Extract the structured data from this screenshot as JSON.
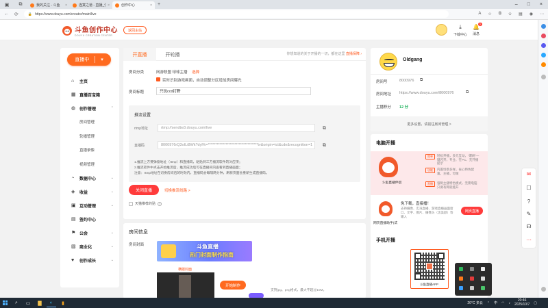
{
  "browser": {
    "tabs": [
      {
        "title": "我的关注 - 斗鱼",
        "active": false
      },
      {
        "title": "连寞之道 - 直播_优寞之道 -",
        "active": false
      },
      {
        "title": "创作中心",
        "active": true
      }
    ],
    "url": "https://www.douyu.com/creator/main/live"
  },
  "header": {
    "logo_text": "斗鱼创作中心",
    "logo_sub": "DOUYU CREATION CENTER",
    "home_button": "返回主站",
    "download_label": "下载中心",
    "message_label": "消息",
    "message_badge": "2"
  },
  "sidebar": {
    "live_button": "直播中",
    "items": [
      {
        "label": "主页",
        "icon": "home-icon",
        "type": "main"
      },
      {
        "label": "直播百宝箱",
        "icon": "toolbox-icon",
        "type": "main"
      },
      {
        "label": "创作管理",
        "icon": "location-icon",
        "type": "main",
        "expandable": true
      },
      {
        "label": "房间管理",
        "type": "sub"
      },
      {
        "label": "轮播管理",
        "type": "sub"
      },
      {
        "label": "直播录像",
        "type": "sub"
      },
      {
        "label": "视频管理",
        "type": "sub"
      },
      {
        "label": "数据中心",
        "icon": "data-icon",
        "type": "main",
        "expandable": true
      },
      {
        "label": "收益",
        "icon": "income-icon",
        "type": "main",
        "expandable": true
      },
      {
        "label": "互动管理",
        "icon": "interaction-icon",
        "type": "main",
        "expandable": true
      },
      {
        "label": "签约中心",
        "icon": "contract-icon",
        "type": "main"
      },
      {
        "label": "公会",
        "icon": "guild-icon",
        "type": "main",
        "expandable": true
      },
      {
        "label": "商业化",
        "icon": "business-icon",
        "type": "main",
        "expandable": true
      },
      {
        "label": "创作成长",
        "icon": "growth-icon",
        "type": "main",
        "expandable": true
      }
    ]
  },
  "main": {
    "tab_active": "开直播",
    "tab_inactive": "开轮播",
    "notice_text": "你想知道的关于开播的一切，都在这里",
    "notice_link": "直播保障",
    "category_label": "房间分类",
    "category_value": "网游联盟 球球主播",
    "category_action": "选择",
    "auto_detect_text": "实时识别游戏画面，自动调整分区增加房间曝光",
    "title_label": "房间标题",
    "title_value": "只玩ccd打野",
    "push": {
      "heading": "推流设置",
      "rtmp_label": "rtmp地址",
      "rtmp_value": "rtmp://sendtw3.douyu.com/live",
      "code_label": "直播码",
      "code_value": "8000976rQ3oILi8Wk?dyl%=**********************************tv&origin=tct&cdn&recognition=1",
      "notes": [
        "1.推流上方要弹窗地址（rtmp）和直播码，粘贴到三方播流软件的对应项；",
        "2.推流软件中点击开始推流后，推流成功后可在直播间内查看到直播画面；",
        "注意：rtmp地址在切换房间后的时效内，直播码会每隔两分钟，刷新页面会重新生成直播码。"
      ]
    },
    "close_live_button": "关闭直播",
    "switch_link": "切换推流线路 >",
    "sticky_label": "天猫推荐的贴",
    "room_info_title": "房间信息",
    "room_cover_label": "房间封面",
    "banner_line1": "斗鱼直播",
    "banner_line2": "热门封面制作指南",
    "horizontal_cover_label": "横版封面",
    "make_button": "开始制作",
    "cover_hint": "支持jpg、png格式，最大不超过10M。"
  },
  "profile": {
    "name": "Oldgang",
    "room_no_label": "房间号",
    "room_no": "8000976",
    "room_url_label": "房间地址",
    "room_url": "https://www.douyu.com/8000976",
    "score_label": "主播积分",
    "score": "12 分",
    "more_settings": "更多设置，请前往房间管理 >"
  },
  "pc_live": {
    "title": "电脑开播",
    "caption": "斗鱼直播伴侣",
    "tags": [
      {
        "tag": "简单",
        "text": "轻松开播，多元互动，“爆刷”一键闪开，专业、在PC、无开播提示"
      },
      {
        "tag": "功能",
        "text": "内置场景多样，省心特色配置，主播，可做"
      },
      {
        "tag": "直播",
        "text": "强制主播特色模式，无需电脑只要有网就能开"
      }
    ],
    "web_title": "免下载，直接播！",
    "web_desc": "支持摄像、实况直播、游戏直播画面窗口、文字、图片、摄像头（含美颜）等输入",
    "web_caption": "网页直播助手(试",
    "web_button": "网页直播"
  },
  "mobile_live": {
    "title": "手机开播",
    "qr_caption": "斗鱼直播APP"
  },
  "taskbar": {
    "weather": "20°C 多云",
    "lang": "中",
    "time": "20:46",
    "date": "2025/10/7"
  },
  "colors": {
    "accent": "#ff6a1f",
    "danger": "#ff3b3b",
    "score": "#1cb25b"
  }
}
